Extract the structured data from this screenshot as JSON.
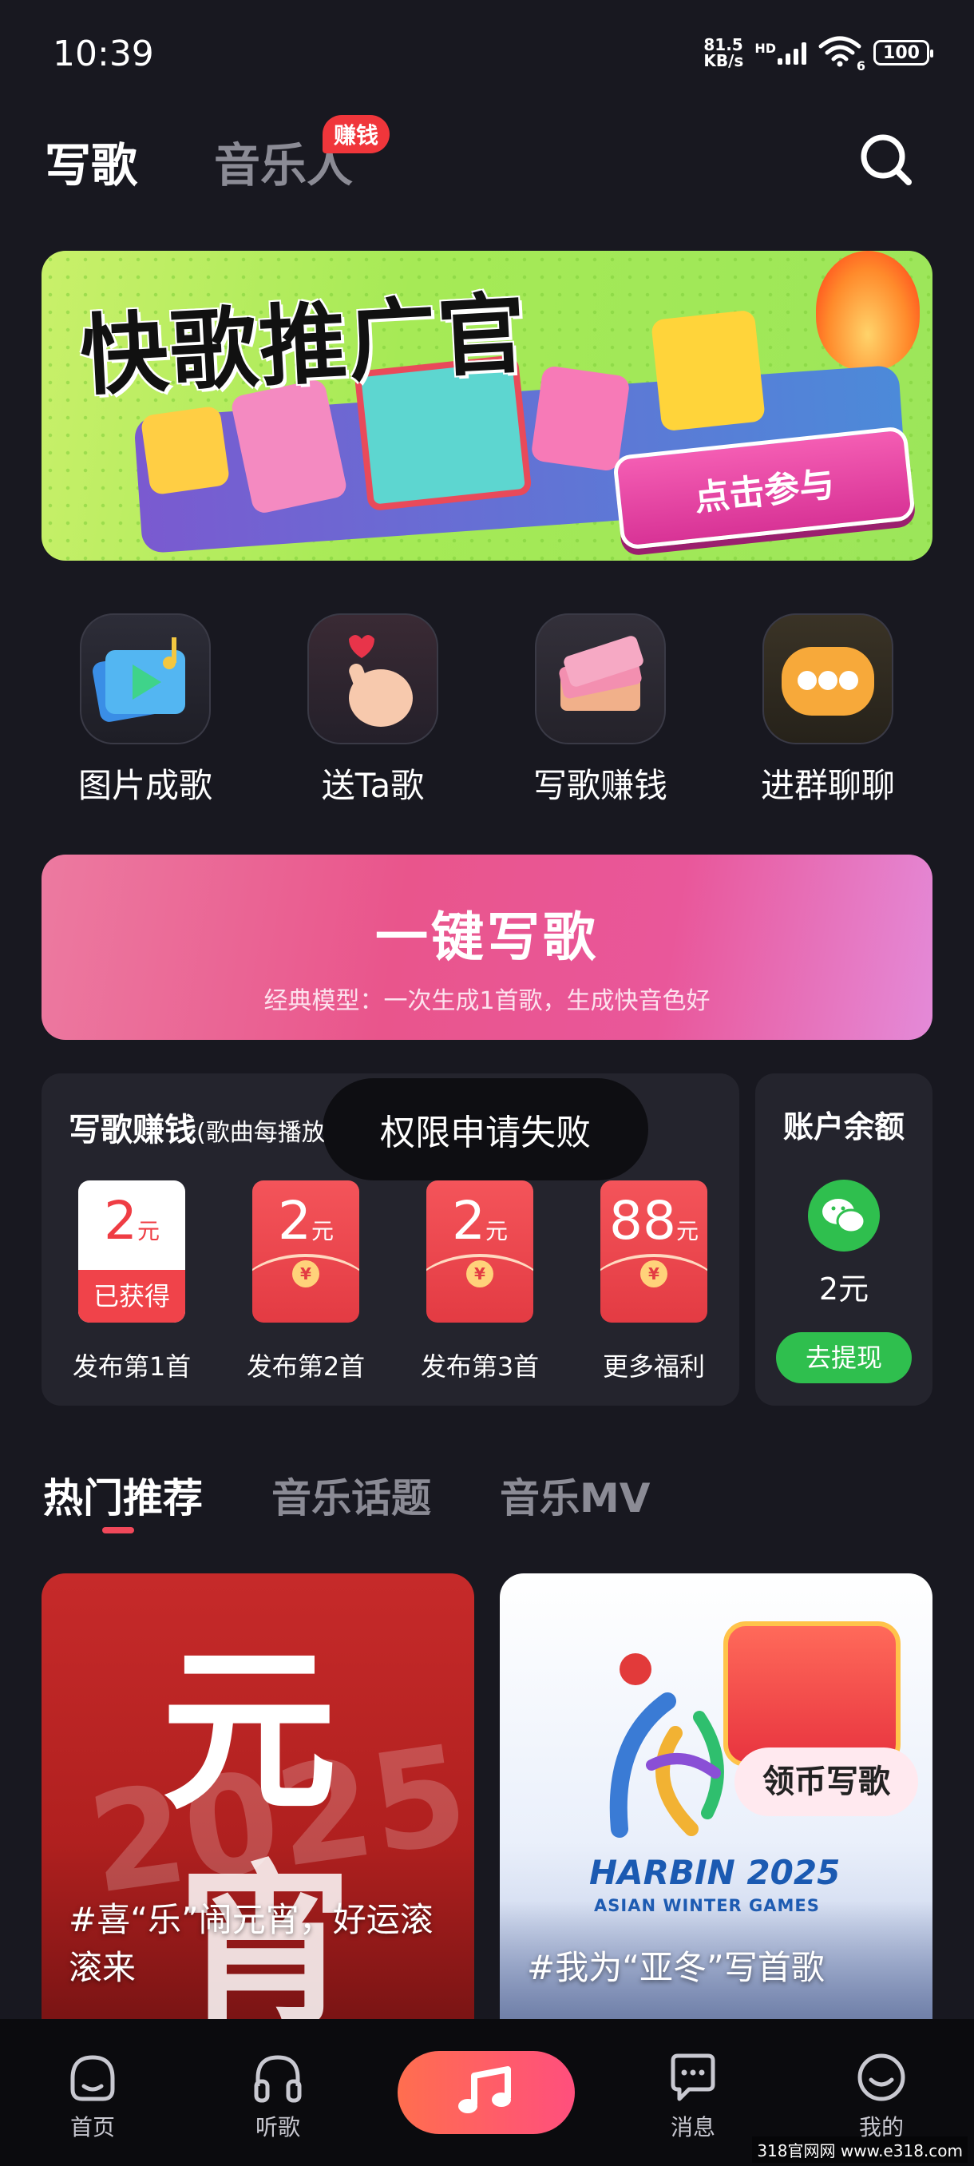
{
  "status_bar": {
    "time": "10:39",
    "net_speed_value": "81.5",
    "net_speed_unit": "KB/s",
    "network_type": "HD",
    "wifi_badge": "6",
    "battery": "100"
  },
  "header": {
    "tab_write": "写歌",
    "tab_musician": "音乐人",
    "musician_badge": "赚钱"
  },
  "banner": {
    "title": "快歌推广官",
    "cta": "点击参与"
  },
  "shortcuts": [
    {
      "label": "图片成歌",
      "icon": "image-to-song-icon"
    },
    {
      "label": "送Ta歌",
      "icon": "heart-hand-icon"
    },
    {
      "label": "写歌赚钱",
      "icon": "money-stack-icon"
    },
    {
      "label": "进群聊聊",
      "icon": "chat-bubble-icon"
    }
  ],
  "onekey": {
    "title": "一键写歌",
    "subtitle": "经典模型：一次生成1首歌，生成快音色好"
  },
  "earn": {
    "title": "写歌赚钱",
    "title_note": "(歌曲每播放1",
    "toast": "权限申请失败",
    "rewards": [
      {
        "amount": "2",
        "unit": "元",
        "status": "已获得",
        "label": "发布第1首"
      },
      {
        "amount": "2",
        "unit": "元",
        "label": "发布第2首"
      },
      {
        "amount": "2",
        "unit": "元",
        "label": "发布第3首"
      },
      {
        "amount": "88",
        "unit": "元",
        "label": "更多福利"
      }
    ]
  },
  "balance": {
    "title": "账户余额",
    "amount": "2元",
    "button": "去提现"
  },
  "content_tabs": [
    "热门推荐",
    "音乐话题",
    "音乐MV"
  ],
  "cards": [
    {
      "caption": "#喜“乐”闹元宵，好运滚滚来",
      "big_text_1": "元",
      "big_text_2": "宵",
      "year": "2025"
    },
    {
      "caption": "#我为“亚冬”写首歌",
      "badge": "领币写歌",
      "logo_title": "HARBIN 2025",
      "logo_sub": "ASIAN WINTER GAMES"
    }
  ],
  "bottom_nav": [
    {
      "label": "首页",
      "icon": "home-face-icon"
    },
    {
      "label": "听歌",
      "icon": "headphones-icon"
    },
    {
      "label": "",
      "icon": "music-note-icon"
    },
    {
      "label": "消息",
      "icon": "message-icon"
    },
    {
      "label": "我的",
      "icon": "smile-icon"
    }
  ],
  "watermark": "318官网网 www.e318.com",
  "colors": {
    "background": "#181820",
    "accent_red": "#f0363b",
    "accent_pink": "#e9558c",
    "wechat_green": "#2fbf4e"
  }
}
